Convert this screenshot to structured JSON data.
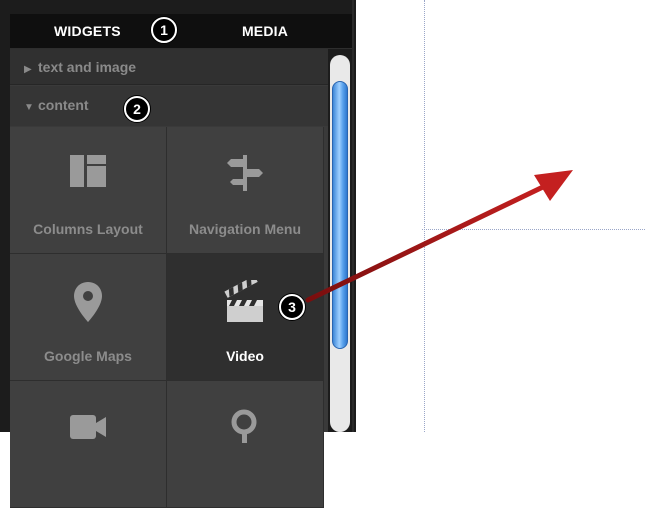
{
  "tabs": [
    {
      "label": "WIDGETS"
    },
    {
      "label": "MEDIA"
    }
  ],
  "sections": [
    {
      "label": "text and image",
      "expanded": false,
      "arrow_icon": "triangle-right-icon"
    },
    {
      "label": "content",
      "expanded": true,
      "arrow_icon": "triangle-down-icon"
    }
  ],
  "widgets": [
    {
      "label": "Columns Layout",
      "icon": "columns-layout-icon",
      "active": false
    },
    {
      "label": "Navigation Menu",
      "icon": "signpost-icon",
      "active": false
    },
    {
      "label": "Google Maps",
      "icon": "map-pin-icon",
      "active": false
    },
    {
      "label": "Video",
      "icon": "clapperboard-icon",
      "active": true
    },
    {
      "label": "",
      "icon": "video-camera-icon",
      "active": false
    },
    {
      "label": "",
      "icon": "search-icon",
      "active": false
    }
  ],
  "callouts": [
    {
      "number": "1"
    },
    {
      "number": "2"
    },
    {
      "number": "3"
    }
  ],
  "colors": {
    "arrow": "#b01a1a",
    "scroll_thumb": "#4a90e2",
    "panel_bg": "#1c1c1c"
  }
}
